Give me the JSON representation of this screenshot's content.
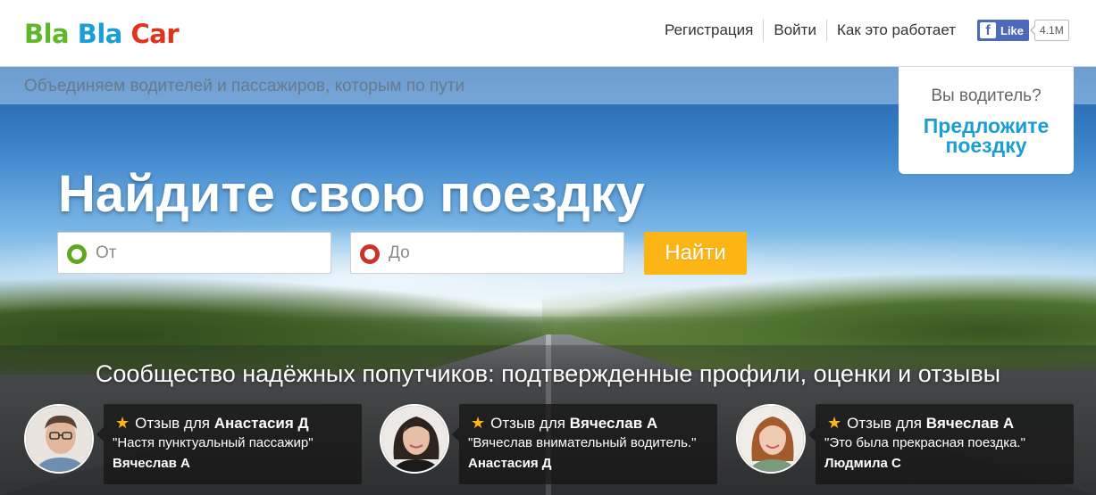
{
  "header": {
    "logo": [
      "Bla",
      "Bla",
      "Car"
    ],
    "nav": [
      "Регистрация",
      "Войти",
      "Как это работает"
    ],
    "facebook": {
      "like_label": "Like",
      "count": "4.1M"
    }
  },
  "hero": {
    "tagline": "Объединяем водителей и пассажиров, которым по пути",
    "title": "Найдите свою поездку",
    "from_placeholder": "От",
    "to_placeholder": "До",
    "search_label": "Найти",
    "driver": {
      "question": "Вы водитель?",
      "cta_line1": "Предложите",
      "cta_line2": "поездку"
    }
  },
  "community": {
    "title": "Сообщество надёжных попутчиков: подтвержденные профили, оценки и отзывы",
    "review_prefix": "Отзыв для",
    "reviews": [
      {
        "for": "Анастасия Д",
        "text": "\"Настя пунктуальный пассажир\"",
        "author": "Вячеслав А"
      },
      {
        "for": "Вячеслав А",
        "text": "\"Вячеслав внимательный водитель.\"",
        "author": "Анастасия Д"
      },
      {
        "for": "Вячеслав А",
        "text": "\"Это была прекрасная поездка.\"",
        "author": "Людмила С"
      }
    ]
  },
  "colors": {
    "brand_green": "#5fb829",
    "brand_blue": "#1a9ed8",
    "brand_red": "#e1331c",
    "cta_yellow": "#fdb515"
  }
}
